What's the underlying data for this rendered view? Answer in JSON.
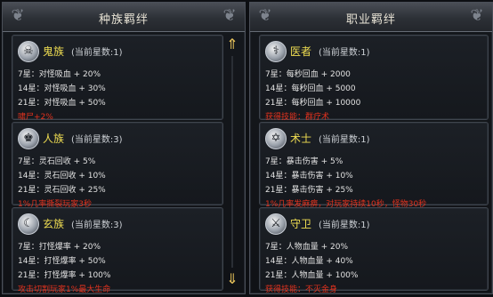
{
  "left_panel": {
    "title": "种族羁绊",
    "cards": [
      {
        "icon": "ghost-race-icon",
        "glyph": "☠",
        "name": "鬼族",
        "stars": "(当前星数:1)",
        "rows": [
          "7星：对怪吸血 + 20%",
          "14星：对怪吸血 + 30%",
          "21星：对怪吸血 + 50%"
        ],
        "note": "啸尸+2%"
      },
      {
        "icon": "human-race-icon",
        "glyph": "♚",
        "name": "人族",
        "stars": "(当前星数:3)",
        "rows": [
          "7星：灵石回收 + 5%",
          "14星：灵石回收 + 10%",
          "21星：灵石回收 + 25%"
        ],
        "note": "1%几率撕裂玩家3秒"
      },
      {
        "icon": "mystic-race-icon",
        "glyph": "☾",
        "name": "玄族",
        "stars": "(当前星数:3)",
        "rows": [
          "7星：打怪爆率 + 20%",
          "14星：打怪爆率 + 50%",
          "21星：打怪爆率 + 100%"
        ],
        "note": "攻击切割玩家1%最大生命"
      }
    ]
  },
  "right_panel": {
    "title": "职业羁绊",
    "cards": [
      {
        "icon": "healer-class-icon",
        "glyph": "⚕",
        "name": "医者",
        "stars": "(当前星数:1)",
        "rows": [
          "7星：每秒回血 + 2000",
          "14星：每秒回血 + 5000",
          "21星：每秒回血 + 10000"
        ],
        "note": "获得技能：群疗术"
      },
      {
        "icon": "mage-class-icon",
        "glyph": "✡",
        "name": "术士",
        "stars": "(当前星数:1)",
        "rows": [
          "7星：暴击伤害 + 5%",
          "14星：暴击伤害 + 10%",
          "21星：暴击伤害 + 25%"
        ],
        "note": "1%几率发麻痹，对玩家持续10秒，怪物30秒"
      },
      {
        "icon": "guardian-class-icon",
        "glyph": "⚔",
        "name": "守卫",
        "stars": "(当前星数:1)",
        "rows": [
          "7星：人物血量 + 20%",
          "14星：人物血量 + 40%",
          "21星：人物血量 + 100%"
        ],
        "note": "获得技能：不灭金身"
      }
    ]
  },
  "scrollbar": {
    "up_glyph": "⇑",
    "down_glyph": "⇓"
  },
  "ornament_glyph": "❦"
}
